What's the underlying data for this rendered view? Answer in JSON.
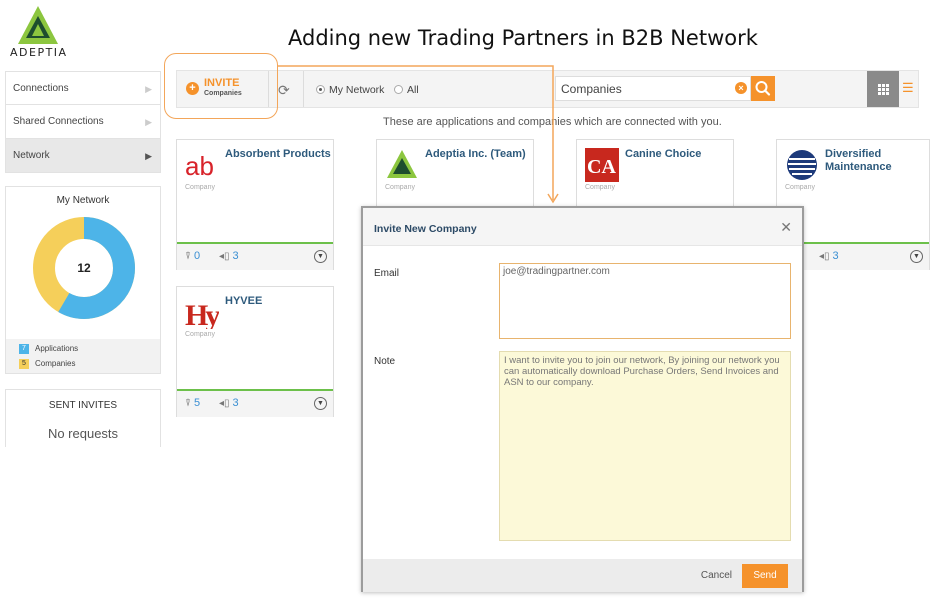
{
  "brand": {
    "name": "ADEPTIA"
  },
  "headline": "Adding new Trading Partners in B2B Network",
  "sidebar": {
    "items": [
      {
        "label": "Connections"
      },
      {
        "label": "Shared Connections"
      },
      {
        "label": "Network",
        "active": true
      }
    ],
    "my_network": {
      "title": "My Network",
      "total": "12",
      "applications": {
        "count": 7,
        "label": "Applications",
        "color": "#4db4e8"
      },
      "companies": {
        "count": 5,
        "label": "Companies",
        "color": "#f5cf5a"
      }
    },
    "sent_invites": {
      "title": "SENT INVITES",
      "empty": "No requests"
    }
  },
  "toolbar": {
    "invite_label": "INVITE",
    "invite_sub": "Companies",
    "refresh_icon": "refresh-icon",
    "radio_my_network": "My Network",
    "radio_all": "All",
    "radio_selected": "My Network",
    "search_value": "Companies",
    "accent": "#f5922b"
  },
  "subtitle": "These are applications and companies which are connected with you.",
  "cards": [
    {
      "name": "Absorbent Products",
      "kind": "Company",
      "apps": "0",
      "companies": "3"
    },
    {
      "name": "Adeptia Inc. (Team)",
      "kind": "Company"
    },
    {
      "name": "Canine Choice",
      "kind": "Company"
    },
    {
      "name": "Diversified Maintenance",
      "kind": "Company",
      "companies": "3"
    },
    {
      "name": "HYVEE",
      "kind": "Company",
      "apps": "5",
      "companies": "3"
    }
  ],
  "modal": {
    "title": "Invite New Company",
    "email_label": "Email",
    "email_value": "joe@tradingpartner.com",
    "note_label": "Note",
    "note_value": "I want to invite you to join our network, By joining our network you can automatically download Purchase Orders, Send Invoices and ASN to our company.",
    "cancel": "Cancel",
    "send": "Send"
  }
}
